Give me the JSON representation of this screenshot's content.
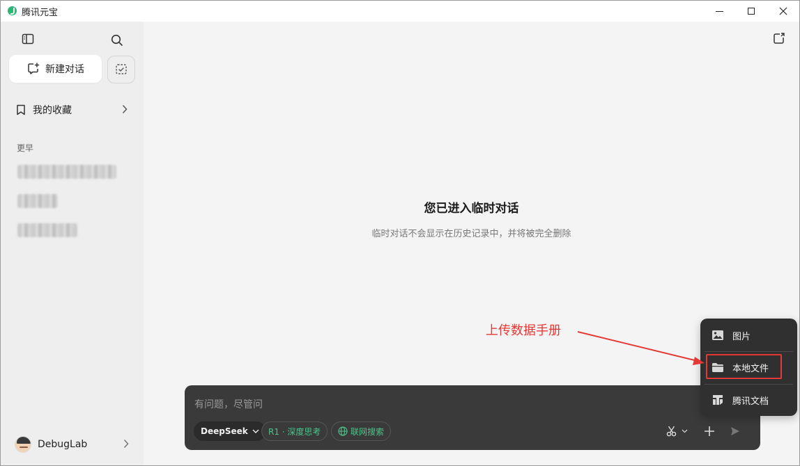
{
  "window": {
    "title": "腾讯元宝",
    "controls": [
      "minimize-icon",
      "maximize-icon",
      "close-icon"
    ]
  },
  "sidebar": {
    "toggle_icon": "sidebar-toggle-icon",
    "search_icon": "search-icon",
    "new_chat_label": "新建对话",
    "temp_chat_icon": "temp-chat-icon",
    "favorites_label": "我的收藏",
    "section_label": "更早",
    "history_items_count_visible": 3,
    "user_name": "DebugLab"
  },
  "main": {
    "temp_title": "您已进入临时对话",
    "temp_subtitle": "临时对话不会显示在历史记录中，并将被完全删除",
    "input": {
      "placeholder": "有问题，尽管问",
      "model_label": "DeepSeek",
      "r1_label": "R1 · 深度思考",
      "web_search_label": "联网搜索"
    }
  },
  "popup": {
    "items": [
      {
        "label": "图片",
        "icon": "image-icon"
      },
      {
        "label": "本地文件",
        "icon": "folder-icon"
      },
      {
        "label": "腾讯文档",
        "icon": "tencent-docs-icon"
      }
    ]
  },
  "annotation": {
    "text": "上传数据手册",
    "color": "#e53935"
  },
  "colors": {
    "accent_green": "#4cc38a",
    "input_bg": "#3a3a3a",
    "popup_bg": "#303030",
    "annotation_red": "#e53935"
  }
}
